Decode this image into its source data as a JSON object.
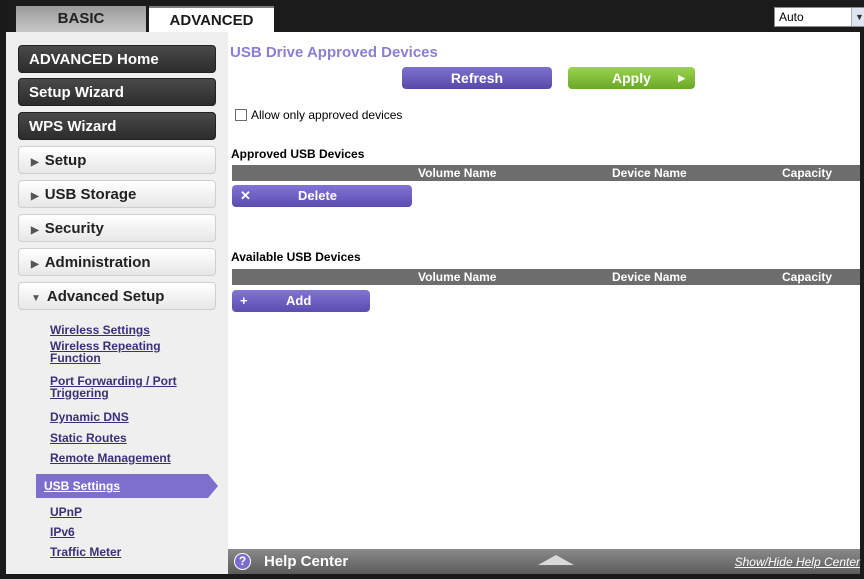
{
  "tabs": {
    "basic": "BASIC",
    "advanced": "ADVANCED"
  },
  "language": {
    "selected": "Auto"
  },
  "sidebar": {
    "advanced_home": "ADVANCED Home",
    "setup_wizard": "Setup Wizard",
    "wps_wizard": "WPS Wizard",
    "setup": "Setup",
    "usb_storage": "USB Storage",
    "security": "Security",
    "administration": "Administration",
    "advanced_setup": "Advanced Setup",
    "sub": {
      "wireless_settings": "Wireless Settings",
      "wireless_repeating_1": "Wireless Repeating",
      "wireless_repeating_2": "Function",
      "port_forwarding_1": "Port Forwarding / Port",
      "port_forwarding_2": "Triggering",
      "dynamic_dns": "Dynamic DNS",
      "static_routes": "Static Routes",
      "remote_management": "Remote Management",
      "usb_settings": "USB Settings",
      "upnp": "UPnP",
      "ipv6": "IPv6",
      "traffic_meter": "Traffic Meter"
    }
  },
  "main": {
    "title": "USB Drive Approved Devices",
    "refresh_label": "Refresh",
    "apply_label": "Apply",
    "allow_only_label": "Allow only approved devices",
    "approved_title": "Approved USB Devices",
    "available_title": "Available USB Devices",
    "columns": {
      "volume": "Volume Name",
      "device": "Device Name",
      "capacity": "Capacity"
    },
    "delete_label": "Delete",
    "add_label": "Add"
  },
  "help": {
    "title": "Help Center",
    "toggle": "Show/Hide Help Center"
  },
  "colors": {
    "accent": "#7e6fcf",
    "apply_green": "#7ab935",
    "header_dark": "#1b1b1b"
  }
}
